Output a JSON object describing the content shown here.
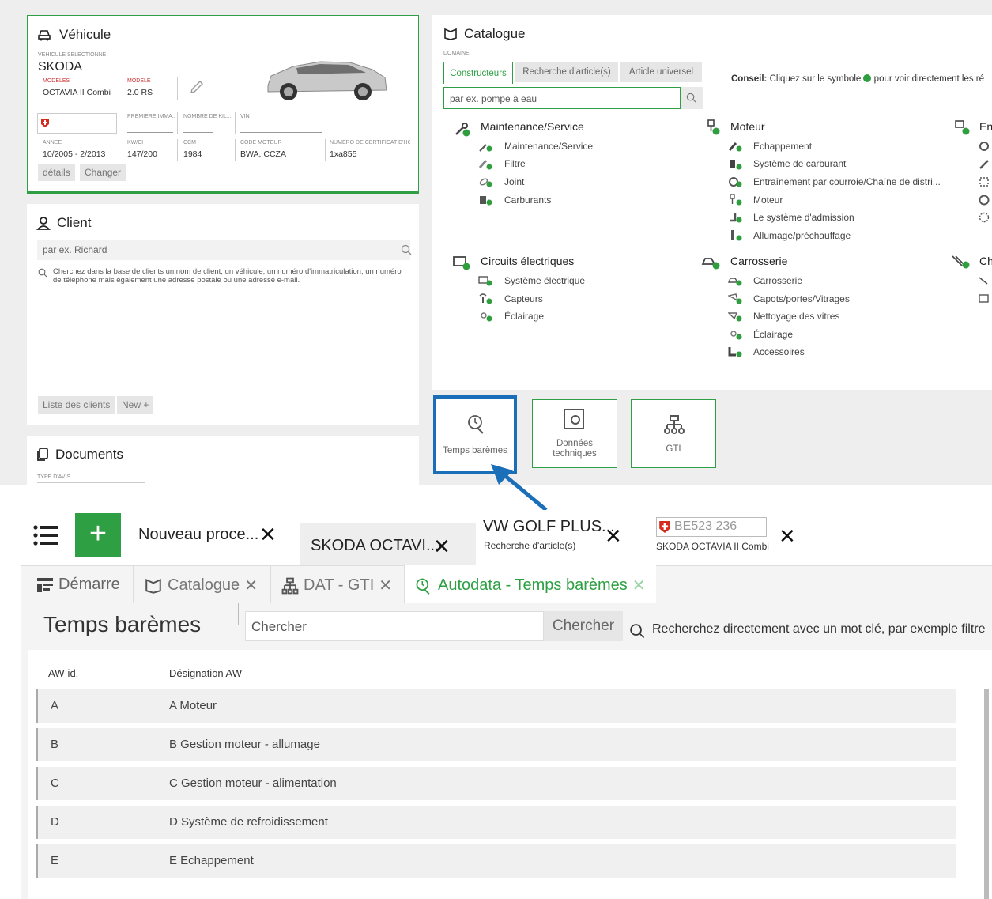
{
  "vehicle": {
    "title": "Véhicule",
    "selected_label": "VÉHICULE SÉLECTIONNÉ",
    "make": "SKODA",
    "models_label": "MODÈLES",
    "models_value": "OCTAVIA II Combi",
    "model_label": "MODÈLE",
    "model_value": "2.0 RS",
    "first_reg_label": "PREMIÈRE IMMA...",
    "km_label": "NOMBRE DE KIL...",
    "vin_label": "VIN",
    "year_label": "ANNÉE",
    "year_value": "10/2005 - 2/2013",
    "kwch_label": "KW/CH",
    "kwch_value": "147/200",
    "ccm_label": "CCM",
    "ccm_value": "1984",
    "engine_code_label": "CODE MOTEUR",
    "engine_code_value": "BWA, CCZA",
    "cert_label": "NUMÉRO DE CERTIFICAT D'HO...",
    "cert_value": "1xa855",
    "details_btn": "détails",
    "change_btn": "Changer"
  },
  "client": {
    "title": "Client",
    "search_placeholder": "par ex. Richard",
    "hint": "Cherchez dans la base de clients un nom de client, un véhicule, un numéro d'immatriculation, un numéro de téléphone mais également une adresse postale ou une adresse e-mail.",
    "list_btn": "Liste des clients",
    "new_btn": "New"
  },
  "documents": {
    "title": "Documents",
    "type_label": "TYPE D'AVIS"
  },
  "catalogue": {
    "title": "Catalogue",
    "domain_label": "DOMAINE",
    "tabs": [
      "Constructeurs",
      "Recherche d'article(s)",
      "Article universel"
    ],
    "search_placeholder": "par ex. pompe à eau",
    "tip_bold": "Conseil:",
    "tip_text": "Cliquez sur le symbole",
    "tip_text2": "pour voir directement les ré",
    "groups": [
      {
        "title": "Maintenance/Service",
        "items": [
          "Maintenance/Service",
          "Filtre",
          "Joint",
          "Carburants"
        ]
      },
      {
        "title": "Moteur",
        "items": [
          "Echappement",
          "Système de carburant",
          "Entraînement par courroie/Chaîne de distri...",
          "Moteur",
          "Le système d'admission",
          "Allumage/préchauffage"
        ]
      },
      {
        "title": "En"
      },
      {
        "title": "Circuits électriques",
        "items": [
          "Système électrique",
          "Capteurs",
          "Éclairage"
        ]
      },
      {
        "title": "Carrosserie",
        "items": [
          "Carrosserie",
          "Capots/portes/Vitrages",
          "Nettoyage des vitres",
          "Éclairage",
          "Accessoires"
        ]
      },
      {
        "title": "Ch"
      }
    ]
  },
  "tiles": {
    "labor_times": "Temps barèmes",
    "tech_data_1": "Données",
    "tech_data_2": "techniques",
    "gti": "GTI"
  },
  "tabbar": {
    "new_process": "Nouveau proce...",
    "skoda_tab": "SKODA OCTAVI...",
    "vw_title": "VW GOLF PLUS...",
    "vw_sub": "Recherche d'article(s)",
    "plate": "BE523 236",
    "plate_sub": "SKODA OCTAVIA II Combi"
  },
  "subtabs": {
    "start": "Démarre",
    "catalogue": "Catalogue",
    "dat_gti": "DAT - GTI",
    "autodata": "Autodata - Temps barèmes"
  },
  "labor": {
    "title": "Temps barèmes",
    "search_placeholder": "Chercher",
    "search_btn": "Chercher",
    "hint": "Recherchez directement avec un mot clé, par exemple filtre",
    "col_id": "AW-id.",
    "col_name": "Désignation AW",
    "rows": [
      {
        "id": "A",
        "name": "A Moteur"
      },
      {
        "id": "B",
        "name": "B Gestion moteur - allumage"
      },
      {
        "id": "C",
        "name": "C Gestion moteur - alimentation"
      },
      {
        "id": "D",
        "name": "D Système de refroidissement"
      },
      {
        "id": "E",
        "name": "E Echappement"
      }
    ]
  },
  "colors": {
    "accent": "#2ea043",
    "highlight": "#1a6fb8"
  }
}
